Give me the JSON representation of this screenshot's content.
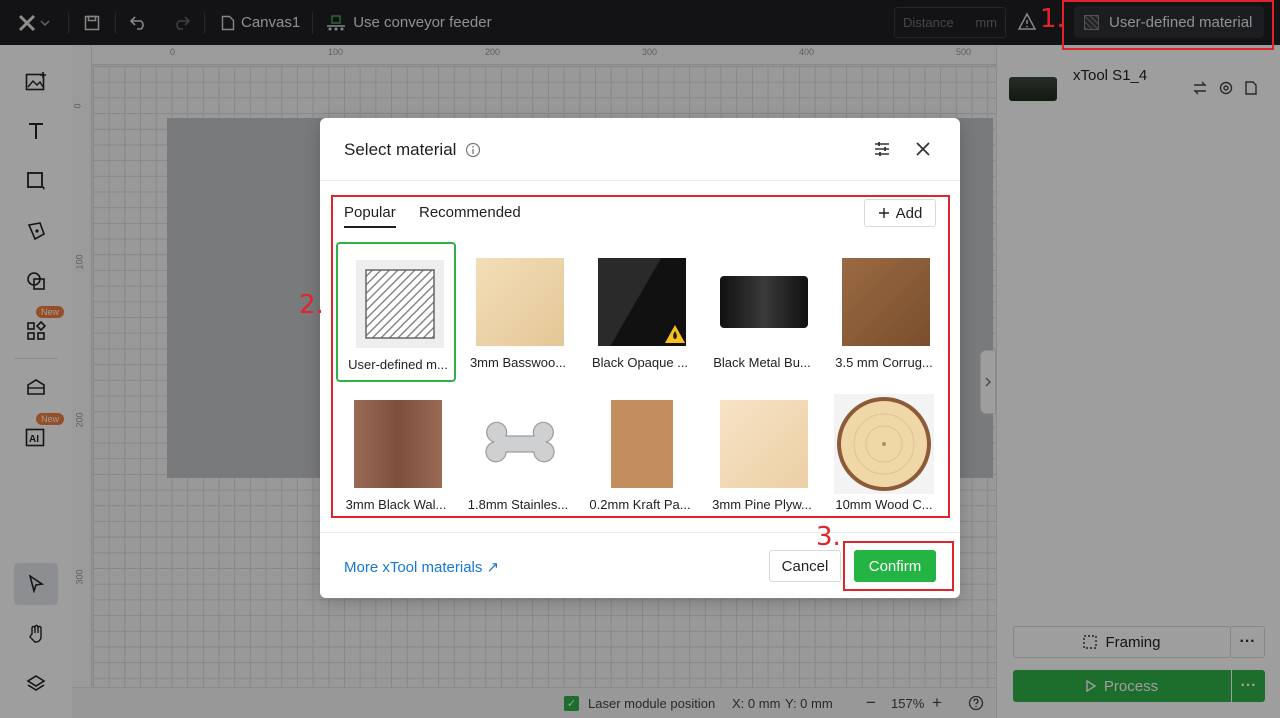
{
  "topbar": {
    "canvas_name": "Canvas1",
    "conveyor_label": "Use conveyor feeder",
    "distance_placeholder": "Distance",
    "distance_unit": "mm",
    "material_button_label": "User-defined material"
  },
  "rulers": {
    "top_ticks": [
      "0",
      "100",
      "200",
      "300",
      "400",
      "500"
    ],
    "left_ticks": [
      "0",
      "100",
      "200",
      "300"
    ]
  },
  "leftbar": {
    "badge_new_1": "New",
    "badge_new_2": "New"
  },
  "right_panel": {
    "device_name": "xTool S1_4",
    "framing_label": "Framing",
    "process_label": "Process",
    "more_label": "···"
  },
  "statusbar": {
    "laser_module_label": "Laser module position",
    "x_coord": "X: 0 mm",
    "y_coord": "Y: 0 mm",
    "zoom_minus": "−",
    "zoom_value": "157%",
    "zoom_plus": "+"
  },
  "modal": {
    "title": "Select material",
    "tabs": [
      "Popular",
      "Recommended"
    ],
    "add_label": "Add",
    "materials": [
      {
        "label": "User-defined m...",
        "color": "#ffffff"
      },
      {
        "label": "3mm Basswoo...",
        "color": "#ecd3a8"
      },
      {
        "label": "Black Opaque ...",
        "color": "#1d1d1d"
      },
      {
        "label": "Black Metal Bu...",
        "color": "#2a2a2a"
      },
      {
        "label": "3.5 mm Corrug...",
        "color": "#8a5a35"
      },
      {
        "label": "3mm Black Wal...",
        "color": "#8e5e45"
      },
      {
        "label": "1.8mm Stainles...",
        "color": "#cfcfcf"
      },
      {
        "label": "0.2mm Kraft Pa...",
        "color": "#c08a5c"
      },
      {
        "label": "3mm Pine Plyw...",
        "color": "#f2dcbc"
      },
      {
        "label": "10mm Wood C...",
        "color": "#e9cf9f"
      }
    ],
    "more_link": "More xTool materials ↗",
    "cancel_label": "Cancel",
    "confirm_label": "Confirm"
  },
  "annotations": [
    "1.",
    "2.",
    "3."
  ]
}
